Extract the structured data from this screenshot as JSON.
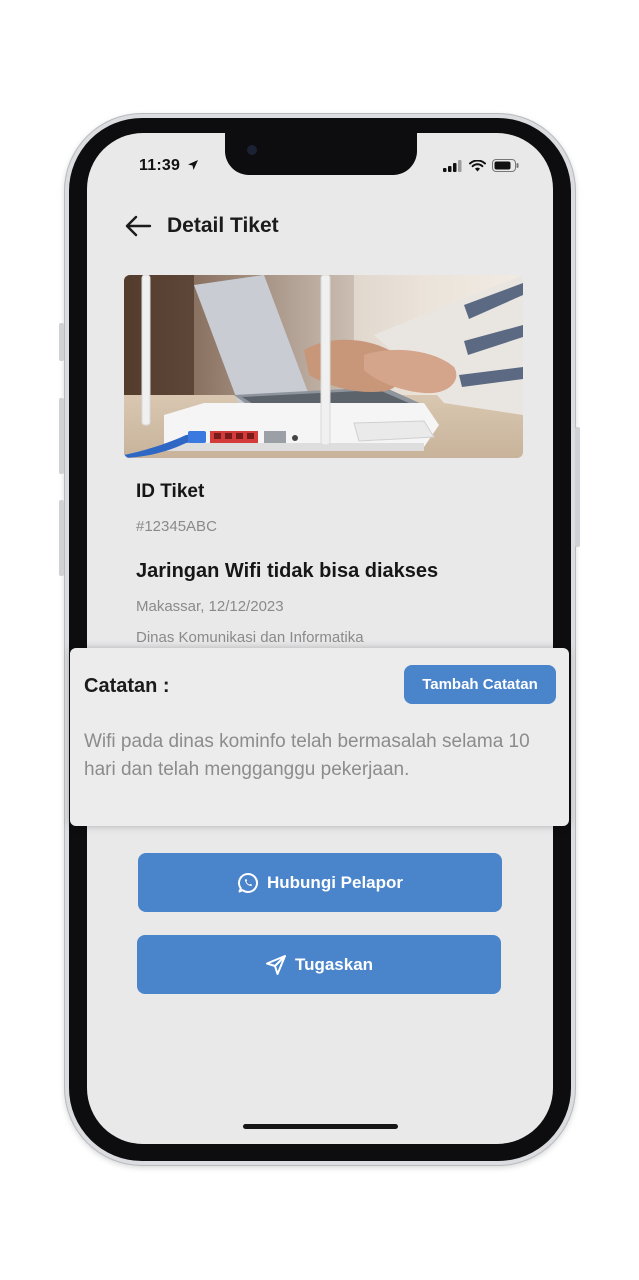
{
  "status_bar": {
    "time": "11:39",
    "location_icon": "location-arrow-icon",
    "signal_icon": "cellular-signal-icon",
    "wifi_icon": "wifi-icon",
    "battery_icon": "battery-icon"
  },
  "header": {
    "back_icon": "arrow-left-icon",
    "title": "Detail Tiket"
  },
  "ticket": {
    "image": "wifi-router-photo",
    "id_label": "ID Tiket",
    "id_value": "#12345ABC",
    "issue_title": "Jaringan Wifi tidak bisa diakses",
    "location_date": "Makassar, 12/12/2023",
    "department": "Dinas Komunikasi dan Informatika"
  },
  "notes": {
    "label": "Catatan :",
    "add_button": "Tambah Catatan",
    "text": "Wifi pada dinas kominfo telah bermasalah selama 10 hari dan telah mengganggu pekerjaan."
  },
  "actions": {
    "contact_label": "Hubungi Pelapor",
    "contact_icon": "whatsapp-icon",
    "assign_label": "Tugaskan",
    "assign_icon": "send-icon"
  },
  "colors": {
    "accent": "#4a84cb",
    "screen_bg": "#e9e9ea",
    "muted_text": "#8a8a8a"
  }
}
